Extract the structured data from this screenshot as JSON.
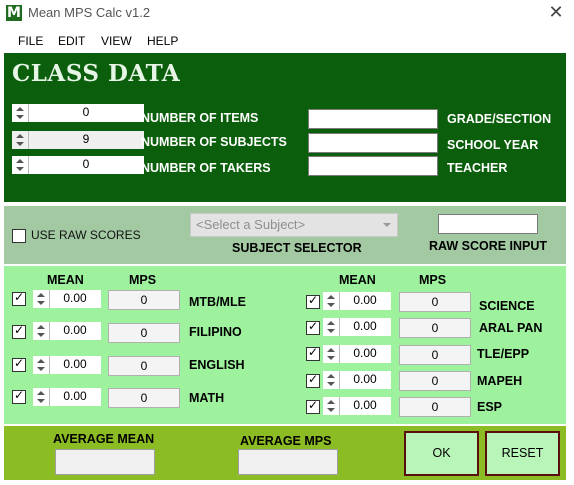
{
  "window": {
    "title": "Mean MPS Calc v1.2",
    "icon_letter": "M",
    "close_glyph": "✕"
  },
  "menu": [
    "FILE",
    "EDIT",
    "VIEW",
    "HELP"
  ],
  "class_data": {
    "title": "CLASS DATA",
    "number_of_items": {
      "value": "0",
      "label": "NUMBER OF ITEMS"
    },
    "number_of_subjects": {
      "value": "9",
      "label": "NUMBER OF SUBJECTS"
    },
    "number_of_takers": {
      "value": "0",
      "label": "NUMBER OF TAKERS"
    },
    "grade_section": {
      "value": "",
      "label": "GRADE/SECTION"
    },
    "school_year": {
      "value": "",
      "label": "SCHOOL YEAR"
    },
    "teacher": {
      "value": "",
      "label": "TEACHER"
    }
  },
  "raw": {
    "use_raw_scores_label": "USE RAW SCORES",
    "use_raw_scores_checked": false,
    "subject_placeholder": "<Select a Subject>",
    "subject_selector_label": "SUBJECT SELECTOR",
    "raw_score_input_label": "RAW SCORE INPUT",
    "raw_score_value": ""
  },
  "scores": {
    "mean_header": "MEAN",
    "mps_header": "MPS",
    "left": [
      {
        "subject": "MTB/MLE",
        "mean": "0.00",
        "mps": "0",
        "checked": true
      },
      {
        "subject": "FILIPINO",
        "mean": "0.00",
        "mps": "0",
        "checked": true
      },
      {
        "subject": "ENGLISH",
        "mean": "0.00",
        "mps": "0",
        "checked": true
      },
      {
        "subject": "MATH",
        "mean": "0.00",
        "mps": "0",
        "checked": true
      }
    ],
    "right": [
      {
        "subject": "SCIENCE",
        "mean": "0.00",
        "mps": "0",
        "checked": true
      },
      {
        "subject": "ARAL PAN",
        "mean": "0.00",
        "mps": "0",
        "checked": true
      },
      {
        "subject": "TLE/EPP",
        "mean": "0.00",
        "mps": "0",
        "checked": true
      },
      {
        "subject": "MAPEH",
        "mean": "0.00",
        "mps": "0",
        "checked": true
      },
      {
        "subject": "ESP",
        "mean": "0.00",
        "mps": "0",
        "checked": true
      }
    ]
  },
  "summary": {
    "average_mean_label": "AVERAGE MEAN",
    "average_mean_value": "",
    "average_mps_label": "AVERAGE MPS",
    "average_mps_value": "",
    "ok_label": "OK",
    "reset_label": "RESET"
  },
  "colors": {
    "top_panel": "#0b5e0b",
    "middle_panel": "#a3c9a3",
    "scores_panel": "#9ef29e",
    "bottom_panel": "#8cbc23",
    "button_fill": "#b9f5b9",
    "button_border": "#5a0f0f"
  }
}
